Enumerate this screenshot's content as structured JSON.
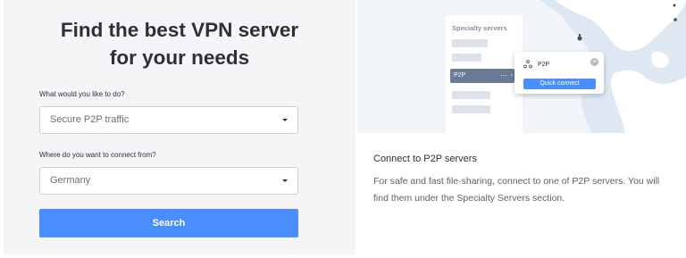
{
  "finder": {
    "title_line1": "Find the best VPN server",
    "title_line2": "for your needs",
    "question_activity": "What would you like to do?",
    "activity_value": "Secure P2P traffic",
    "question_location": "Where do you want to connect from?",
    "location_value": "Germany",
    "search_label": "Search"
  },
  "preview": {
    "section_label": "Specialty servers",
    "selected_item": "P2P",
    "more_icon": "⋯",
    "chevron_icon": "›",
    "popup": {
      "title": "P2P",
      "icon": "p2p-icon",
      "close_icon": "×",
      "button_label": "Quick connect"
    }
  },
  "info": {
    "title": "Connect to P2P servers",
    "description": "For safe and fast file-sharing, connect to one of P2P servers. You will find them under the Specialty Servers section."
  },
  "colors": {
    "accent": "#4c8dfd",
    "panel_bg": "#f5f5f7",
    "map_land": "#ffffff",
    "map_water": "#dde8f3"
  }
}
